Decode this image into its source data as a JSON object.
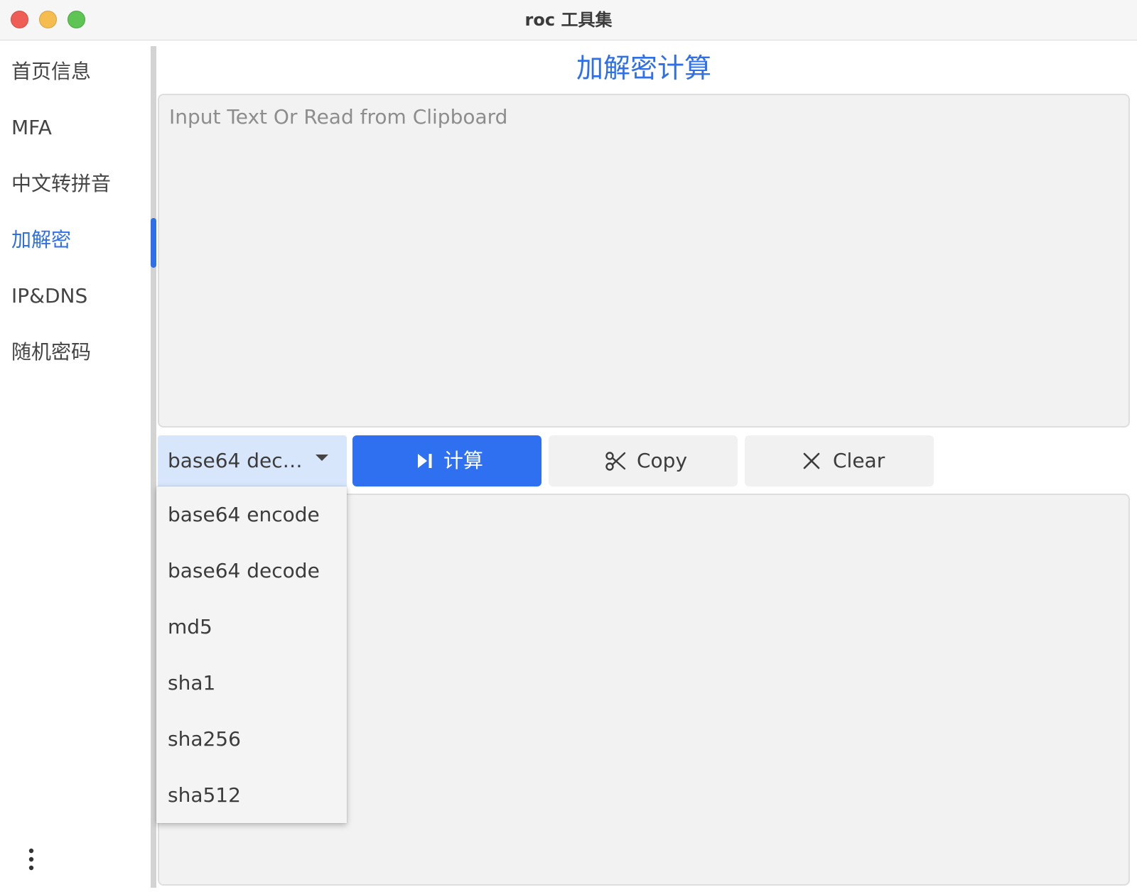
{
  "window": {
    "title": "roc 工具集"
  },
  "sidebar": {
    "items": [
      {
        "label": "首页信息",
        "active": false
      },
      {
        "label": "MFA",
        "active": false
      },
      {
        "label": "中文转拼音",
        "active": false
      },
      {
        "label": "加解密",
        "active": true
      },
      {
        "label": "IP&DNS",
        "active": false
      },
      {
        "label": "随机密码",
        "active": false
      }
    ],
    "more_icon": "vertical-ellipsis-icon"
  },
  "main": {
    "title": "加解密计算",
    "input": {
      "placeholder": "Input Text Or Read from Clipboard",
      "value": ""
    },
    "algorithm_select": {
      "selected_display": "base64 dec…",
      "options": [
        "base64 encode",
        "base64 decode",
        "md5",
        "sha1",
        "sha256",
        "sha512"
      ]
    },
    "buttons": {
      "compute": {
        "label": "计算",
        "icon": "skip-next-icon"
      },
      "copy": {
        "label": "Copy",
        "icon": "scissors-icon"
      },
      "clear": {
        "label": "Clear",
        "icon": "close-icon"
      }
    },
    "output": {
      "value": ""
    }
  },
  "colors": {
    "accent": "#2f6fe8",
    "primary_button": "#2e70ef",
    "select_background": "#d7e6fb",
    "field_background": "#f2f2f2"
  }
}
